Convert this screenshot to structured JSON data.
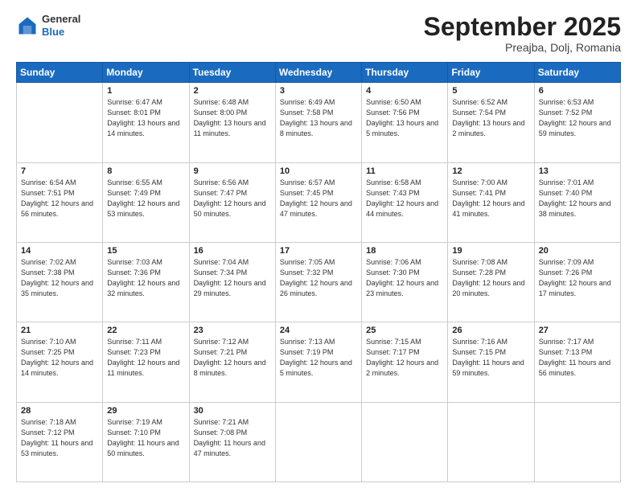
{
  "header": {
    "logo_general": "General",
    "logo_blue": "Blue",
    "month": "September 2025",
    "location": "Preajba, Dolj, Romania"
  },
  "days_of_week": [
    "Sunday",
    "Monday",
    "Tuesday",
    "Wednesday",
    "Thursday",
    "Friday",
    "Saturday"
  ],
  "weeks": [
    [
      {
        "day": "",
        "info": ""
      },
      {
        "day": "1",
        "info": "Sunrise: 6:47 AM\nSunset: 8:01 PM\nDaylight: 13 hours\nand 14 minutes."
      },
      {
        "day": "2",
        "info": "Sunrise: 6:48 AM\nSunset: 8:00 PM\nDaylight: 13 hours\nand 11 minutes."
      },
      {
        "day": "3",
        "info": "Sunrise: 6:49 AM\nSunset: 7:58 PM\nDaylight: 13 hours\nand 8 minutes."
      },
      {
        "day": "4",
        "info": "Sunrise: 6:50 AM\nSunset: 7:56 PM\nDaylight: 13 hours\nand 5 minutes."
      },
      {
        "day": "5",
        "info": "Sunrise: 6:52 AM\nSunset: 7:54 PM\nDaylight: 13 hours\nand 2 minutes."
      },
      {
        "day": "6",
        "info": "Sunrise: 6:53 AM\nSunset: 7:52 PM\nDaylight: 12 hours\nand 59 minutes."
      }
    ],
    [
      {
        "day": "7",
        "info": "Sunrise: 6:54 AM\nSunset: 7:51 PM\nDaylight: 12 hours\nand 56 minutes."
      },
      {
        "day": "8",
        "info": "Sunrise: 6:55 AM\nSunset: 7:49 PM\nDaylight: 12 hours\nand 53 minutes."
      },
      {
        "day": "9",
        "info": "Sunrise: 6:56 AM\nSunset: 7:47 PM\nDaylight: 12 hours\nand 50 minutes."
      },
      {
        "day": "10",
        "info": "Sunrise: 6:57 AM\nSunset: 7:45 PM\nDaylight: 12 hours\nand 47 minutes."
      },
      {
        "day": "11",
        "info": "Sunrise: 6:58 AM\nSunset: 7:43 PM\nDaylight: 12 hours\nand 44 minutes."
      },
      {
        "day": "12",
        "info": "Sunrise: 7:00 AM\nSunset: 7:41 PM\nDaylight: 12 hours\nand 41 minutes."
      },
      {
        "day": "13",
        "info": "Sunrise: 7:01 AM\nSunset: 7:40 PM\nDaylight: 12 hours\nand 38 minutes."
      }
    ],
    [
      {
        "day": "14",
        "info": "Sunrise: 7:02 AM\nSunset: 7:38 PM\nDaylight: 12 hours\nand 35 minutes."
      },
      {
        "day": "15",
        "info": "Sunrise: 7:03 AM\nSunset: 7:36 PM\nDaylight: 12 hours\nand 32 minutes."
      },
      {
        "day": "16",
        "info": "Sunrise: 7:04 AM\nSunset: 7:34 PM\nDaylight: 12 hours\nand 29 minutes."
      },
      {
        "day": "17",
        "info": "Sunrise: 7:05 AM\nSunset: 7:32 PM\nDaylight: 12 hours\nand 26 minutes."
      },
      {
        "day": "18",
        "info": "Sunrise: 7:06 AM\nSunset: 7:30 PM\nDaylight: 12 hours\nand 23 minutes."
      },
      {
        "day": "19",
        "info": "Sunrise: 7:08 AM\nSunset: 7:28 PM\nDaylight: 12 hours\nand 20 minutes."
      },
      {
        "day": "20",
        "info": "Sunrise: 7:09 AM\nSunset: 7:26 PM\nDaylight: 12 hours\nand 17 minutes."
      }
    ],
    [
      {
        "day": "21",
        "info": "Sunrise: 7:10 AM\nSunset: 7:25 PM\nDaylight: 12 hours\nand 14 minutes."
      },
      {
        "day": "22",
        "info": "Sunrise: 7:11 AM\nSunset: 7:23 PM\nDaylight: 12 hours\nand 11 minutes."
      },
      {
        "day": "23",
        "info": "Sunrise: 7:12 AM\nSunset: 7:21 PM\nDaylight: 12 hours\nand 8 minutes."
      },
      {
        "day": "24",
        "info": "Sunrise: 7:13 AM\nSunset: 7:19 PM\nDaylight: 12 hours\nand 5 minutes."
      },
      {
        "day": "25",
        "info": "Sunrise: 7:15 AM\nSunset: 7:17 PM\nDaylight: 12 hours\nand 2 minutes."
      },
      {
        "day": "26",
        "info": "Sunrise: 7:16 AM\nSunset: 7:15 PM\nDaylight: 11 hours\nand 59 minutes."
      },
      {
        "day": "27",
        "info": "Sunrise: 7:17 AM\nSunset: 7:13 PM\nDaylight: 11 hours\nand 56 minutes."
      }
    ],
    [
      {
        "day": "28",
        "info": "Sunrise: 7:18 AM\nSunset: 7:12 PM\nDaylight: 11 hours\nand 53 minutes."
      },
      {
        "day": "29",
        "info": "Sunrise: 7:19 AM\nSunset: 7:10 PM\nDaylight: 11 hours\nand 50 minutes."
      },
      {
        "day": "30",
        "info": "Sunrise: 7:21 AM\nSunset: 7:08 PM\nDaylight: 11 hours\nand 47 minutes."
      },
      {
        "day": "",
        "info": ""
      },
      {
        "day": "",
        "info": ""
      },
      {
        "day": "",
        "info": ""
      },
      {
        "day": "",
        "info": ""
      }
    ]
  ]
}
